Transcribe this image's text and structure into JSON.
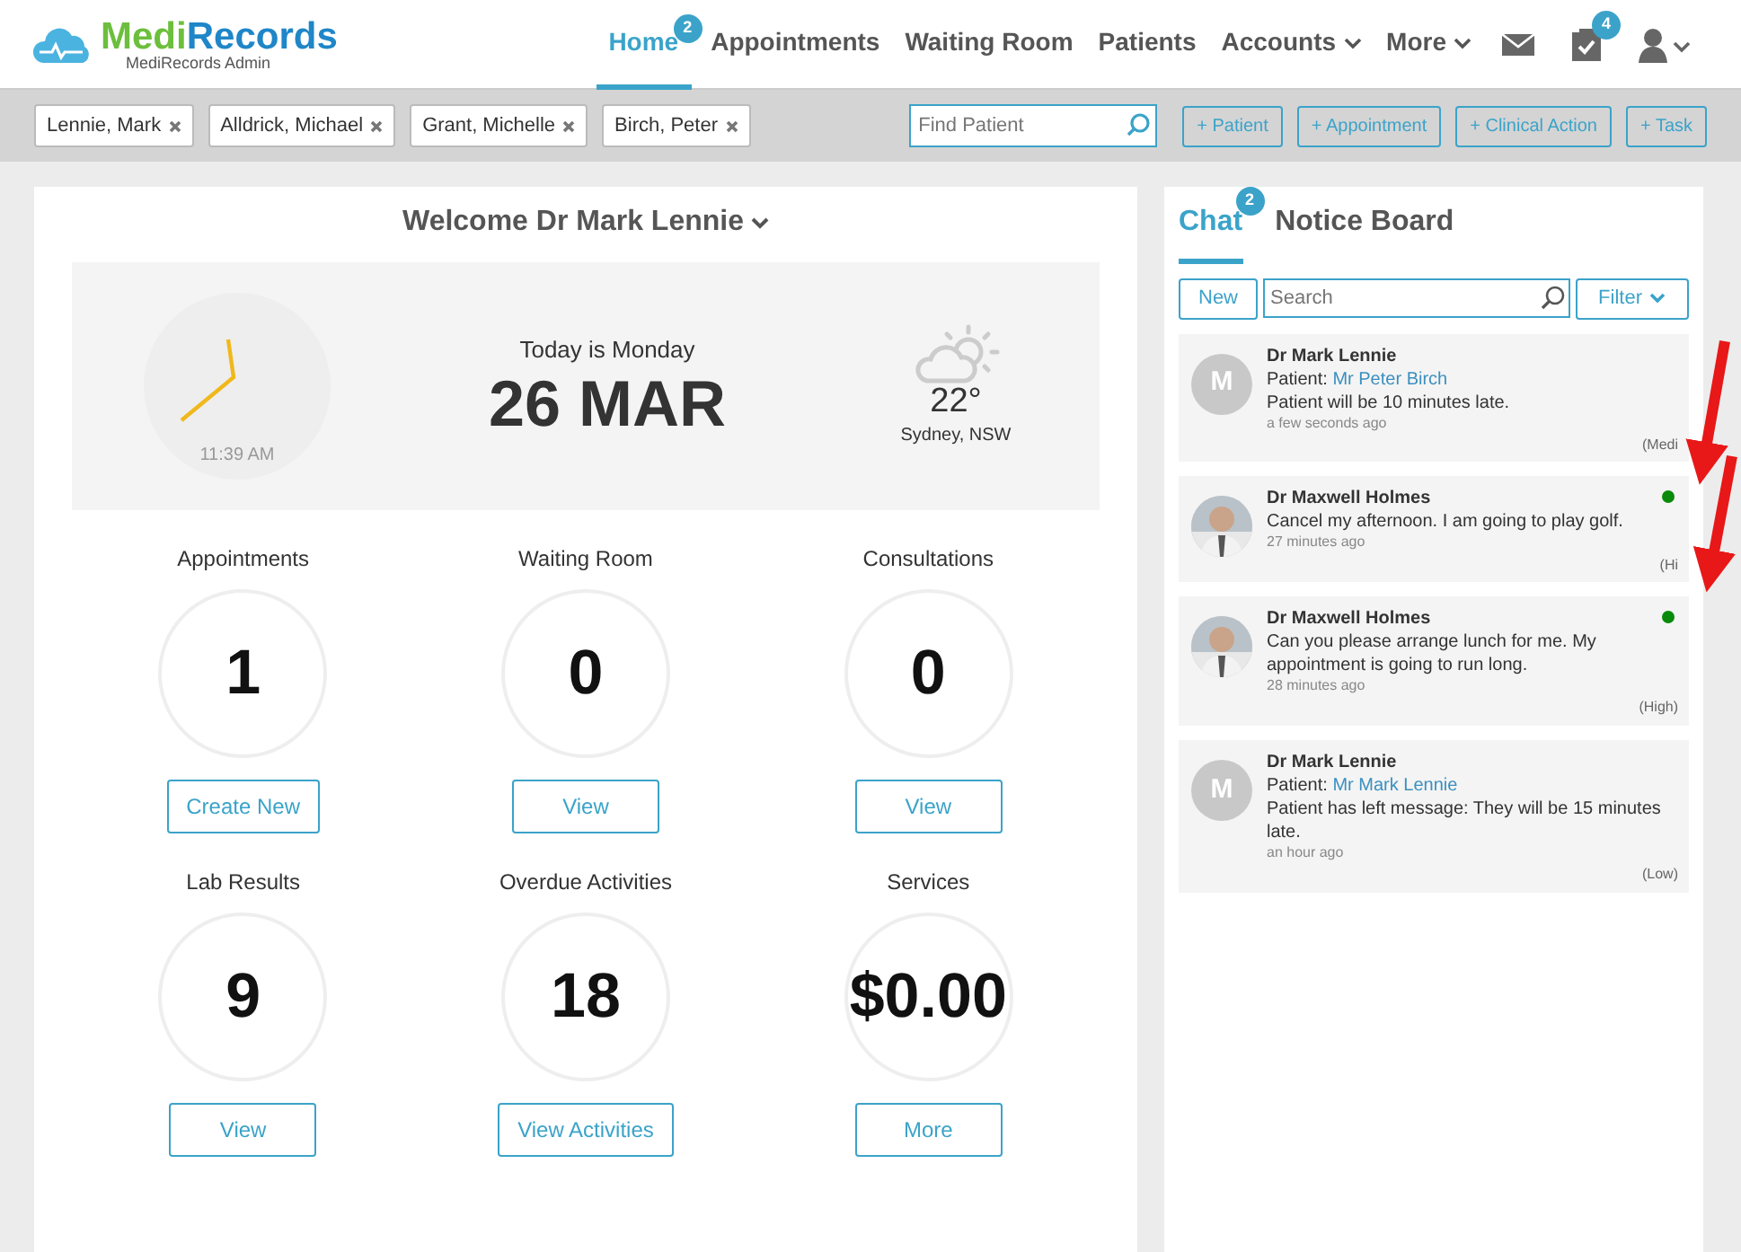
{
  "brand": {
    "name_part1": "Medi",
    "name_part2": "Records",
    "subtitle": "MediRecords Admin"
  },
  "nav": [
    {
      "label": "Home",
      "selected": true,
      "badge": "2",
      "dropdown": false
    },
    {
      "label": "Appointments",
      "selected": false,
      "dropdown": false
    },
    {
      "label": "Waiting Room",
      "selected": false,
      "dropdown": false
    },
    {
      "label": "Patients",
      "selected": false,
      "dropdown": false
    },
    {
      "label": "Accounts",
      "selected": false,
      "dropdown": true
    },
    {
      "label": "More",
      "selected": false,
      "dropdown": true
    }
  ],
  "nav_icons": [
    {
      "kind": "mail"
    },
    {
      "kind": "tasks",
      "badge": "4"
    },
    {
      "kind": "user"
    }
  ],
  "patient_tabs": [
    "Lennie, Mark",
    "Alldrick, Michael",
    "Grant, Michelle",
    "Birch, Peter"
  ],
  "find_patient": {
    "placeholder": "Find Patient"
  },
  "action_buttons": [
    "+ Patient",
    "+ Appointment",
    "+ Clinical Action",
    "+ Task"
  ],
  "welcome": "Welcome Dr Mark Lennie",
  "today": {
    "time": "11:39 AM",
    "day_line": "Today is Monday",
    "date": "26 MAR",
    "temperature": "22°",
    "location": "Sydney, NSW"
  },
  "stats": [
    {
      "label": "Appointments",
      "value": "1",
      "button": "Create New"
    },
    {
      "label": "Waiting Room",
      "value": "0",
      "button": "View"
    },
    {
      "label": "Consultations",
      "value": "0",
      "button": "View"
    },
    {
      "label": "Lab Results",
      "value": "9",
      "button": "View"
    },
    {
      "label": "Overdue Activities",
      "value": "18",
      "button": "View Activities"
    },
    {
      "label": "Services",
      "value": "$0.00",
      "button": "More"
    }
  ],
  "chat_tabs": [
    {
      "label": "Chat",
      "selected": true,
      "badge": "2"
    },
    {
      "label": "Notice Board",
      "selected": false
    }
  ],
  "chat_toolbar": {
    "new_button": "New",
    "search_placeholder": "Search",
    "filter_button": "Filter"
  },
  "messages": [
    {
      "avatar": {
        "kind": "initial",
        "text": "M"
      },
      "sender": "Dr Mark Lennie",
      "patient_label": "Patient:",
      "patient": "Mr Peter Birch",
      "text": "Patient will be 10 minutes late.",
      "time": "a few seconds ago",
      "priority": "(Medi",
      "online": false
    },
    {
      "sender": "Dr Maxwell Holmes",
      "text": "Cancel my afternoon. I am going to play golf.",
      "time": "27 minutes ago",
      "priority": "(Hi",
      "online": true
    },
    {
      "sender": "Dr Maxwell Holmes",
      "text": "Can you please arrange lunch for me. My appointment is going to run long.",
      "time": "28 minutes ago",
      "priority": "(High)",
      "online": true
    },
    {
      "avatar": {
        "kind": "initial",
        "text": "M"
      },
      "sender": "Dr Mark Lennie",
      "patient_label": "Patient:",
      "patient": "Mr Mark Lennie",
      "text": "Patient has left message: They will be 15 minutes late.",
      "time": "an hour ago",
      "priority": "(Low)",
      "online": false
    }
  ]
}
